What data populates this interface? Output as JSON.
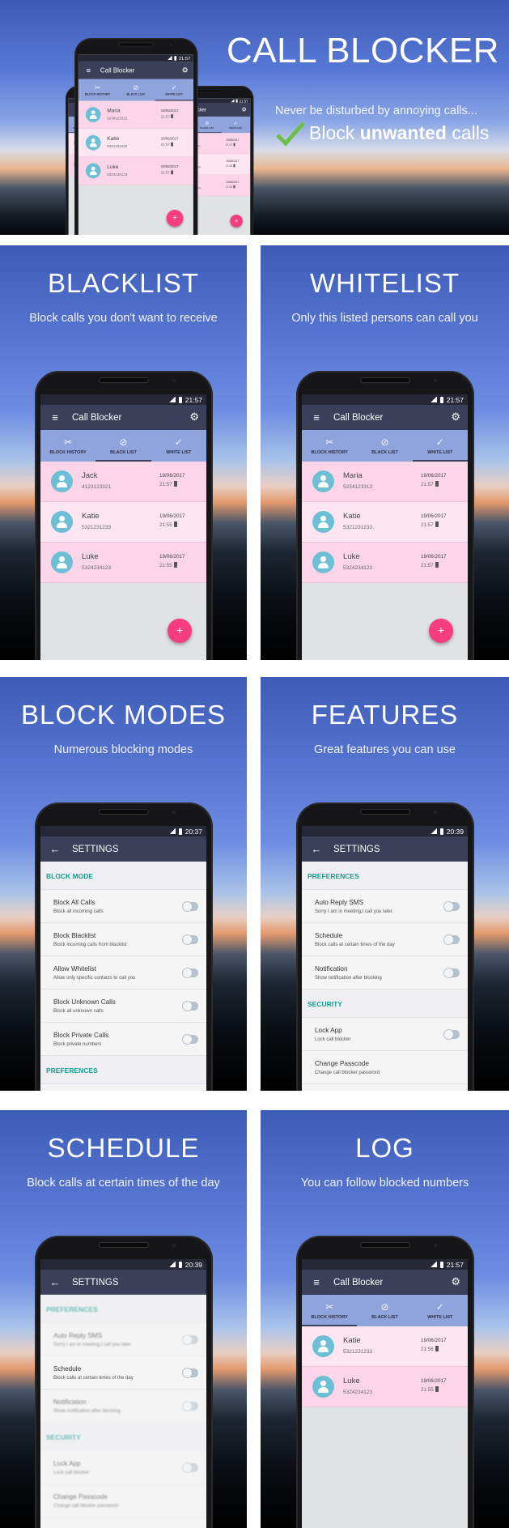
{
  "colors": {
    "toolbar": "#3b3f5a",
    "tabs": "#8fa3dc",
    "row_pink": "#fcd6e8",
    "fab": "#f73d7f",
    "avatar": "#6cbfd4",
    "section_teal": "#1a9c8c",
    "check_green": "#6cc04a"
  },
  "app": {
    "title": "Call Blocker",
    "tabs": [
      {
        "label": "BLOCK HISTORY",
        "icon": "block-history-icon"
      },
      {
        "label": "BLACK LIST",
        "icon": "block-icon"
      },
      {
        "label": "WHITE LIST",
        "icon": "check-icon"
      }
    ],
    "fab": "+",
    "settings_title": "SETTINGS"
  },
  "banner": {
    "title": "CALL BLOCKER",
    "tagline": "Never be disturbed by annoying calls...",
    "check_pre": "Block ",
    "check_bold": "unwanted",
    "check_post": " calls",
    "phones": [
      {
        "time": "21:57",
        "active_tab": 0,
        "fab": false,
        "rows": [
          {
            "name": "Katie",
            "number": "5321231233",
            "date": "19/06/2017",
            "time": "21:56"
          },
          {
            "name": "Luke",
            "number": "5324234123",
            "date": "19/06/2017",
            "time": "21:55"
          }
        ]
      },
      {
        "time": "21:57",
        "active_tab": 1,
        "fab": true,
        "rows": [
          {
            "name": "Jack",
            "number": "4123123321",
            "date": "19/06/2017",
            "time": "21:57"
          },
          {
            "name": "Katie",
            "number": "5321231233",
            "date": "19/06/2017",
            "time": "21:56"
          },
          {
            "name": "Luke",
            "number": "5324234123",
            "date": "19/06/2017",
            "time": "21:56"
          }
        ]
      },
      {
        "time": "21:57",
        "active_tab": 2,
        "fab": true,
        "rows": [
          {
            "name": "Maria",
            "number": "5234123312",
            "date": "19/06/2017",
            "time": "21:57"
          },
          {
            "name": "Katie",
            "number": "5321231233",
            "date": "19/06/2017",
            "time": "21:57"
          },
          {
            "name": "Luke",
            "number": "5324234123",
            "date": "19/06/2017",
            "time": "21:57"
          }
        ]
      }
    ]
  },
  "panels": [
    {
      "title": "BLACKLIST",
      "subtitle": "Block calls you don't want to receive",
      "type": "list",
      "time": "21:57",
      "active_tab": 1,
      "fab": true,
      "rows": [
        {
          "name": "Jack",
          "number": "4123123321",
          "date": "19/06/2017",
          "time": "21:57"
        },
        {
          "name": "Katie",
          "number": "5321231233",
          "date": "19/06/2017",
          "time": "21:55"
        },
        {
          "name": "Luke",
          "number": "5324234123",
          "date": "19/06/2017",
          "time": "21:55"
        }
      ]
    },
    {
      "title": "WHITELIST",
      "subtitle": "Only this listed persons can call you",
      "type": "list",
      "time": "21:57",
      "active_tab": 2,
      "fab": true,
      "rows": [
        {
          "name": "Maria",
          "number": "5234123312",
          "date": "19/06/2017",
          "time": "21:57"
        },
        {
          "name": "Katie",
          "number": "5321231233",
          "date": "19/06/2017",
          "time": "21:57"
        },
        {
          "name": "Luke",
          "number": "5324234123",
          "date": "19/06/2017",
          "time": "21:57"
        }
      ]
    },
    {
      "title": "BLOCK MODES",
      "subtitle": "Numerous blocking modes",
      "type": "settings",
      "time": "20:37",
      "sections": [
        {
          "header": "BLOCK MODE",
          "items": [
            {
              "title": "Block All Calls",
              "subtitle": "Block all incoming calls",
              "toggle": true
            },
            {
              "title": "Block Blacklist",
              "subtitle": "Block incoming calls from blacklist",
              "toggle": true
            },
            {
              "title": "Allow Whitelist",
              "subtitle": "Allow only specific contacts to call you",
              "toggle": true
            },
            {
              "title": "Block Unknown Calls",
              "subtitle": "Block all unknown calls",
              "toggle": true
            },
            {
              "title": "Block Private Calls",
              "subtitle": "Block private numbers",
              "toggle": true
            }
          ]
        },
        {
          "header": "PREFERENCES",
          "items": []
        }
      ]
    },
    {
      "title": "FEATURES",
      "subtitle": "Great features you can use",
      "type": "settings",
      "time": "20:39",
      "sections": [
        {
          "header": "PREFERENCES",
          "items": [
            {
              "title": "Auto Reply SMS",
              "subtitle": "Sorry I am in meeting,I call you later.",
              "toggle": true
            },
            {
              "title": "Schedule",
              "subtitle": "Block calls at certain times of the day",
              "toggle": true
            },
            {
              "title": "Notification",
              "subtitle": "Show notification after blocking",
              "toggle": true
            }
          ]
        },
        {
          "header": "SECURITY",
          "items": [
            {
              "title": "Lock App",
              "subtitle": "Lock call blocker",
              "toggle": true
            },
            {
              "title": "Change Passcode",
              "subtitle": "Change call blocker password",
              "toggle": false
            }
          ]
        }
      ]
    },
    {
      "title": "SCHEDULE",
      "subtitle": "Block calls at certain times of the day",
      "type": "settings",
      "time": "20:39",
      "focus": "Schedule",
      "sections": [
        {
          "header": "PREFERENCES",
          "items": [
            {
              "title": "Auto Reply SMS",
              "subtitle": "Sorry I am in meeting,I call you later.",
              "toggle": true
            },
            {
              "title": "Schedule",
              "subtitle": "Block calls at certain times of the day",
              "toggle": true
            },
            {
              "title": "Notification",
              "subtitle": "Show notification after blocking",
              "toggle": true
            }
          ]
        },
        {
          "header": "SECURITY",
          "items": [
            {
              "title": "Lock App",
              "subtitle": "Lock call blocker",
              "toggle": true
            },
            {
              "title": "Change Passcode",
              "subtitle": "Change call blocker password",
              "toggle": false
            }
          ]
        }
      ]
    },
    {
      "title": "LOG",
      "subtitle": "You can follow blocked numbers",
      "type": "list",
      "time": "21:57",
      "active_tab": 0,
      "fab": false,
      "rows": [
        {
          "name": "Katie",
          "number": "5321231233",
          "date": "19/06/2017",
          "time": "21:56"
        },
        {
          "name": "Luke",
          "number": "5324234123",
          "date": "19/06/2017",
          "time": "21:55"
        }
      ]
    }
  ]
}
